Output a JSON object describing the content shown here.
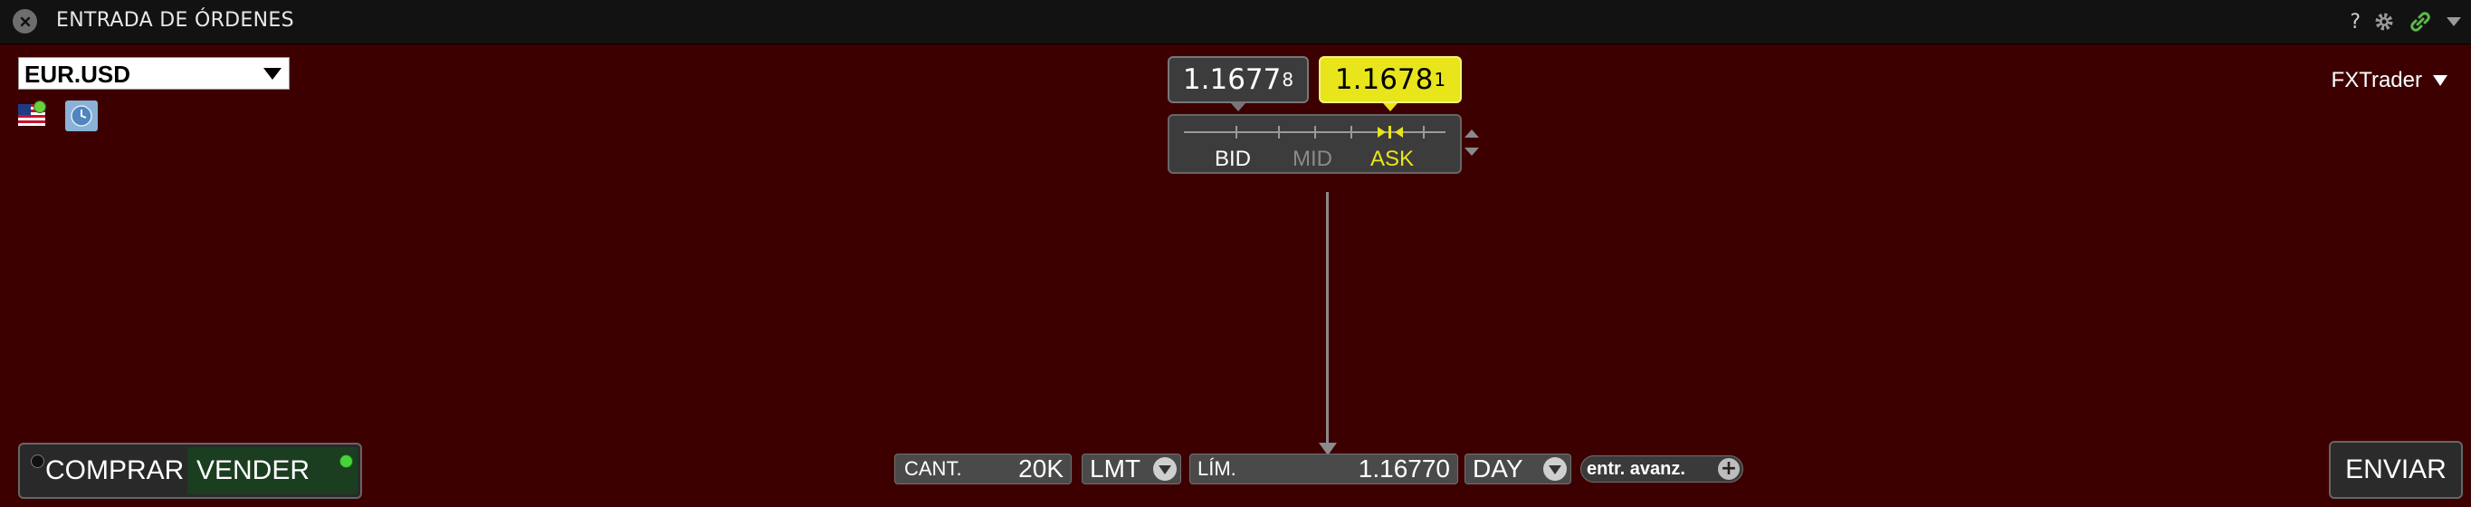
{
  "window": {
    "title": "ENTRADA DE ÓRDENES",
    "help_label": "?",
    "icons": [
      "close-icon",
      "gear-icon",
      "link-icon",
      "chevron-down-icon"
    ]
  },
  "symbol": {
    "value": "EUR.USD",
    "icons": [
      "us-flag-icon",
      "clock-icon"
    ]
  },
  "quote": {
    "bid_main": "1.1677",
    "bid_pip": "8",
    "ask_main": "1.1678",
    "ask_pip": "1",
    "slider_labels": {
      "bid": "BID",
      "mid": "MID",
      "ask": "ASK"
    },
    "colors": {
      "ask": "#e8e51b",
      "bid": "#3c3c3c"
    }
  },
  "trader_menu": {
    "label": "FXTrader"
  },
  "order": {
    "buy_label": "COMPRAR",
    "sell_label": "VENDER",
    "qty_label": "CANT.",
    "qty_value": "20K",
    "order_type": "LMT",
    "limit_label": "LÍM.",
    "limit_value": "1.16770",
    "tif": "DAY",
    "advanced_label": "entr. avanz.",
    "submit_label": "ENVIAR",
    "colors": {
      "background": "#3d0000",
      "sell_active": "#1b3e20",
      "active_dot": "#46d23b"
    }
  }
}
